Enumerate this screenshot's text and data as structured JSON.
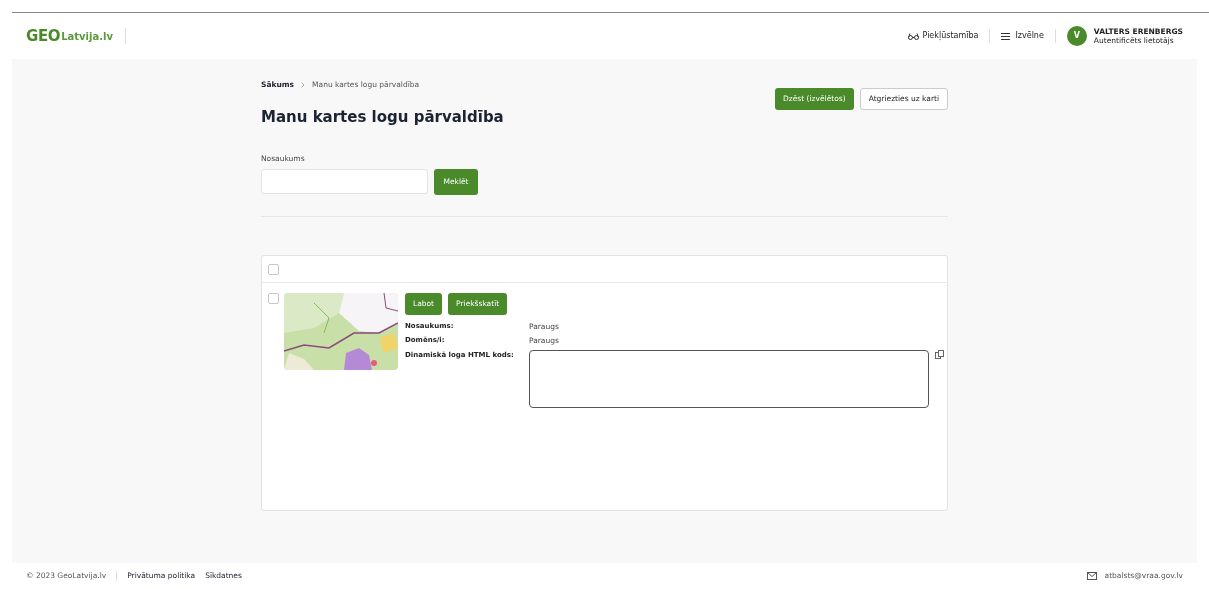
{
  "header": {
    "logo_geo": "GEO",
    "logo_site": "Latvija.lv",
    "accessibility": "Piekļūstamība",
    "menu": "Izvēlne",
    "user": {
      "initial": "V",
      "name": "VALTERS ERENBERGS",
      "role": "Autentificēts lietotājs"
    }
  },
  "breadcrumbs": [
    {
      "label": "Sākums",
      "current": false
    },
    {
      "label": "Manu kartes logu pārvaldība",
      "current": true
    }
  ],
  "title": "Manu kartes logu pārvaldība",
  "actions": [
    {
      "label": "Dzēst (izvēlētos)",
      "kind": "primary"
    },
    {
      "label": "Atgriezties uz karti",
      "kind": "secondary"
    }
  ],
  "search": {
    "label": "Nosaukums",
    "button": "Meklēt"
  },
  "list": {
    "select_all_checked": false,
    "items": [
      {
        "checked": false,
        "buttons": [
          "Labot",
          "Priekšskatīt"
        ],
        "fields": [
          {
            "label": "Nosaukums:",
            "value": "Paraugs",
            "kind": "text"
          },
          {
            "label": "Domēns/i:",
            "value": "Paraugs",
            "kind": "text"
          },
          {
            "label": "Dinamiskā loga HTML kods:",
            "kind": "code"
          }
        ]
      }
    ]
  },
  "footer": {
    "copyright": "© 2023 GeoLatvija.lv",
    "links": [
      "Privātuma politika",
      "Sīkdatnes"
    ],
    "email": "atbalsts@vraa.gov.lv"
  }
}
